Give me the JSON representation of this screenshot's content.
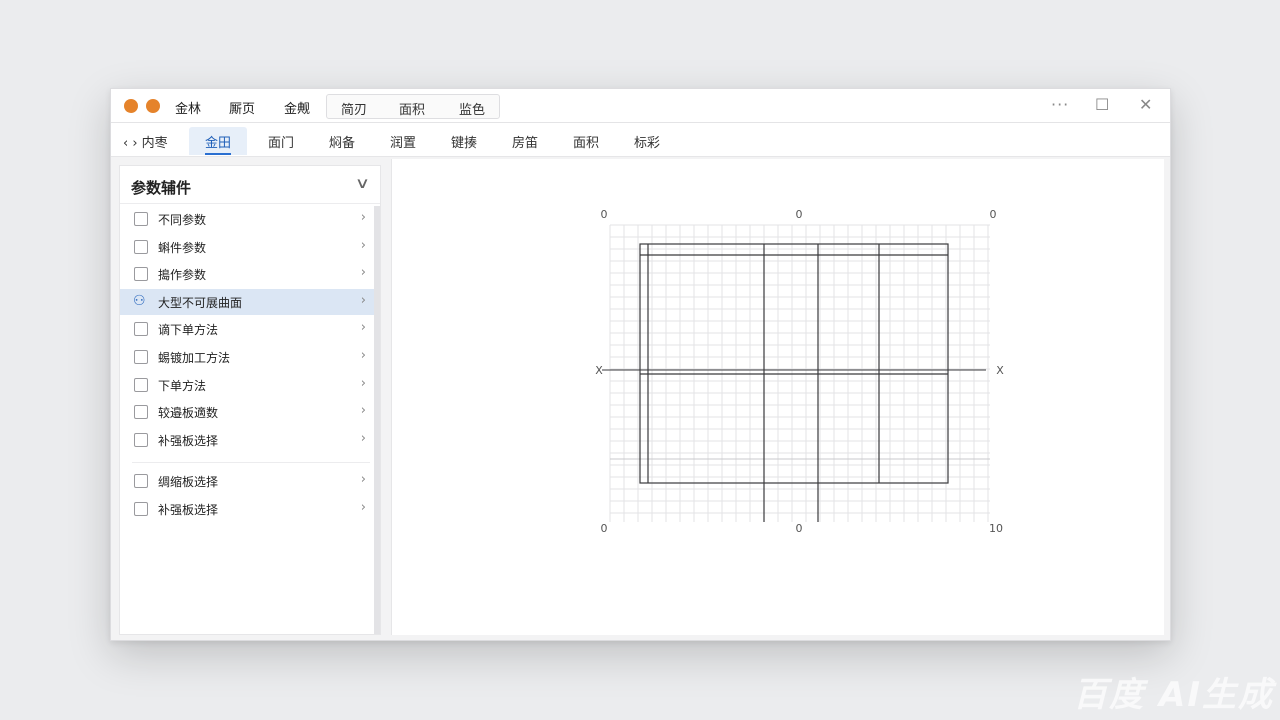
{
  "titlebar": {
    "menu": [
      "金林",
      "厮页",
      "金觍"
    ],
    "group": [
      "简刃",
      "面积",
      "监色"
    ],
    "controls": {
      "more": "···",
      "maximize": "☐",
      "close": "✕"
    }
  },
  "tabs": {
    "back": "‹ › 内枣",
    "items": [
      "金田",
      "面门",
      "焖备",
      "润置",
      "键揍",
      "房笛",
      "面积",
      "标彩"
    ],
    "active_index": 0
  },
  "sidebar": {
    "title": "参数辅件",
    "items": [
      {
        "label": "不同参数",
        "checked": false,
        "selected": false
      },
      {
        "label": "蝌件参数",
        "checked": false,
        "selected": false
      },
      {
        "label": "搗作参数",
        "checked": false,
        "selected": false
      },
      {
        "label": "大型不可展曲面",
        "checked": false,
        "selected": true
      },
      {
        "label": "谪下单方法",
        "checked": false,
        "selected": false
      },
      {
        "label": "蜴镀加工方法",
        "checked": false,
        "selected": false
      },
      {
        "label": "下单方法",
        "checked": false,
        "selected": false
      },
      {
        "label": "较邉板適数",
        "checked": false,
        "selected": false
      },
      {
        "label": "补强板选择",
        "checked": false,
        "selected": false
      }
    ],
    "items2": [
      {
        "label": "绸缩板选择",
        "checked": false,
        "selected": false
      },
      {
        "label": "补强板选择",
        "checked": false,
        "selected": false
      }
    ]
  },
  "drawing": {
    "top_labels": [
      "0",
      "0",
      "0"
    ],
    "bottom_labels": [
      "0",
      "0",
      "10"
    ],
    "side_labels": [
      "X",
      "X"
    ]
  },
  "watermark": "百度 AI生成"
}
